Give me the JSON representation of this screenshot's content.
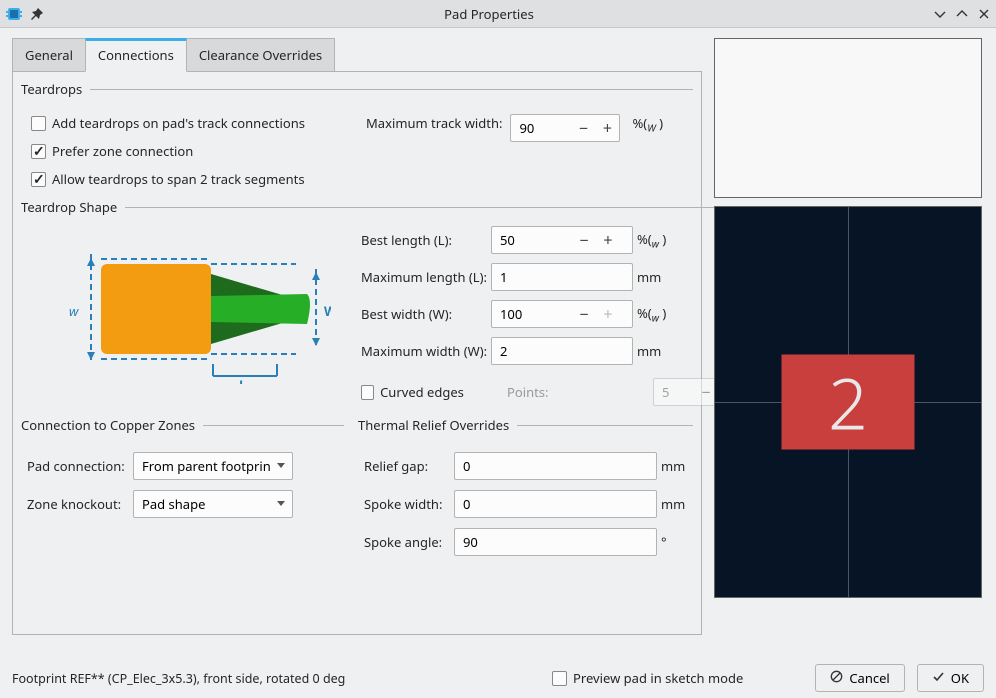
{
  "window": {
    "title": "Pad Properties"
  },
  "tabs": {
    "general": "General",
    "connections": "Connections",
    "clearance": "Clearance Overrides",
    "active": "connections"
  },
  "teardrops": {
    "legend": "Teardrops",
    "add_teardrops": "Add teardrops on pad's track connections",
    "add_teardrops_checked": false,
    "prefer_zone": "Prefer zone connection",
    "prefer_zone_checked": true,
    "allow_span": "Allow teardrops to span 2 track segments",
    "allow_span_checked": true,
    "max_track_width_label": "Maximum track width:",
    "max_track_width_value": "90",
    "max_track_width_unit": "%(",
    "max_track_width_sub": "W",
    "max_track_width_close": " )"
  },
  "shape": {
    "legend": "Teardrop Shape",
    "best_length_label": "Best length (L):",
    "best_length_value": "50",
    "best_length_unit": "%(",
    "best_length_sub": "w",
    "best_length_close": " )",
    "max_length_label": "Maximum length (L):",
    "max_length_value": "1",
    "max_length_unit": "mm",
    "best_width_label": "Best width (W):",
    "best_width_value": "100",
    "best_width_unit": "%(",
    "best_width_sub": "w",
    "best_width_close": " )",
    "max_width_label": "Maximum width (W):",
    "max_width_value": "2",
    "max_width_unit": "mm",
    "curved_edges_label": "Curved edges",
    "curved_edges_checked": false,
    "points_label": "Points:",
    "points_value": "5",
    "diagram": {
      "w_label": "w",
      "W_label": "W",
      "L_label": "L"
    }
  },
  "zones": {
    "legend": "Connection to Copper Zones",
    "pad_connection_label": "Pad connection:",
    "pad_connection_value": "From parent footprint",
    "zone_knockout_label": "Zone knockout:",
    "zone_knockout_value": "Pad shape"
  },
  "relief": {
    "legend": "Thermal Relief Overrides",
    "gap_label": "Relief gap:",
    "gap_value": "0",
    "gap_unit": "mm",
    "spoke_width_label": "Spoke width:",
    "spoke_width_value": "0",
    "spoke_width_unit": "mm",
    "spoke_angle_label": "Spoke angle:",
    "spoke_angle_value": "90",
    "spoke_angle_unit": "°"
  },
  "preview": {
    "pad_number": "2"
  },
  "footer": {
    "status": "Footprint REF** (CP_Elec_3x5.3), front side, rotated 0 deg",
    "preview_sketch_label": "Preview pad in sketch mode",
    "preview_sketch_checked": false,
    "cancel": "Cancel",
    "ok": "OK"
  }
}
